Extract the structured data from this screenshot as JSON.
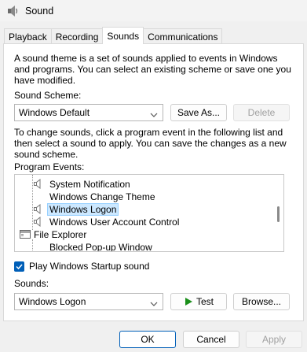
{
  "window": {
    "title": "Sound",
    "icon": "speaker-app-icon"
  },
  "tabs": [
    {
      "label": "Playback",
      "active": false
    },
    {
      "label": "Recording",
      "active": false
    },
    {
      "label": "Sounds",
      "active": true
    },
    {
      "label": "Communications",
      "active": false
    }
  ],
  "sounds": {
    "theme_description": [
      "A sound theme is a set of sounds applied to events in Windows",
      "and programs.  You can select an existing scheme or save one you",
      "have modified."
    ],
    "scheme_label": "Sound Scheme:",
    "scheme_value": "Windows Default",
    "save_as_label": "Save As...",
    "delete_label": "Delete",
    "instructions": [
      "To change sounds, click a program event in the following list and",
      "then select a sound to apply.  You can save the changes as a new",
      "sound scheme."
    ],
    "program_events_label": "Program Events:",
    "events": [
      {
        "label": "System Notification",
        "icon": "speaker-icon",
        "selected": false
      },
      {
        "label": "Windows Change Theme",
        "icon": "",
        "selected": false
      },
      {
        "label": "Windows Logon",
        "icon": "speaker-icon",
        "selected": true
      },
      {
        "label": "Windows User Account Control",
        "icon": "speaker-icon",
        "selected": false
      },
      {
        "label": "File Explorer",
        "icon": "folder-icon",
        "selected": false
      },
      {
        "label": "Blocked Pop-up Window",
        "icon": "",
        "selected": false
      }
    ],
    "startup_checkbox_label": "Play Windows Startup sound",
    "startup_checked": true,
    "sounds_label": "Sounds:",
    "sound_value": "Windows Logon",
    "test_label": "Test",
    "browse_label": "Browse..."
  },
  "footer": {
    "ok_label": "OK",
    "cancel_label": "Cancel",
    "apply_label": "Apply"
  },
  "colors": {
    "accent": "#005fb8",
    "selection": "#cce8ff",
    "test_icon": "#1a8f1a"
  }
}
